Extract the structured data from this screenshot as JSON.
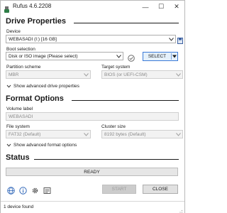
{
  "window": {
    "title": "Rufus 4.6.2208",
    "controls": {
      "minimize": "—",
      "maximize": "☐",
      "close": "✕"
    }
  },
  "drive_properties": {
    "heading": "Drive Properties",
    "device": {
      "label": "Device",
      "value": "WEBASADI (I:) [16 GB]"
    },
    "boot_selection": {
      "label": "Boot selection",
      "value": "Disk or ISO image (Please select)",
      "select_label": "SELECT"
    },
    "partition_scheme": {
      "label": "Partition scheme",
      "value": "MBR"
    },
    "target_system": {
      "label": "Target system",
      "value": "BIOS (or UEFI-CSM)"
    },
    "advanced_toggle": "Show advanced drive properties"
  },
  "format_options": {
    "heading": "Format Options",
    "volume_label": {
      "label": "Volume label",
      "value": "WEBASADI"
    },
    "file_system": {
      "label": "File system",
      "value": "FAT32 (Default)"
    },
    "cluster_size": {
      "label": "Cluster size",
      "value": "8192 bytes (Default)"
    },
    "advanced_toggle": "Show advanced format options"
  },
  "status": {
    "heading": "Status",
    "progress_text": "READY",
    "progress_fraction": 0
  },
  "buttons": {
    "start": "START",
    "close": "CLOSE"
  },
  "toolbar_icons": [
    "globe-icon",
    "info-icon",
    "settings-icon",
    "log-icon"
  ],
  "statusbar": {
    "text": "1 device found"
  },
  "colors": {
    "accent": "#3c7bd8",
    "select_fill": "#e5f1fb",
    "progress": "#06b025"
  }
}
